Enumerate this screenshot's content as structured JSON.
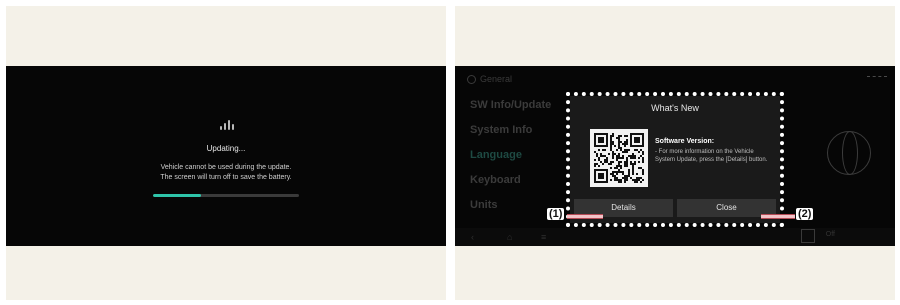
{
  "left_screen": {
    "title": "Updating...",
    "message_line1": "Vehicle cannot be used during the update.",
    "message_line2": "The screen will turn off to save the battery.",
    "progress_fraction": 0.33,
    "icons": {
      "spinner": "loading-icon"
    }
  },
  "right_screen": {
    "background": {
      "header": "General",
      "menu": [
        {
          "label": "SW Info/Update",
          "accent": false
        },
        {
          "label": "System Info",
          "accent": false
        },
        {
          "label": "Language",
          "accent": true
        },
        {
          "label": "Keyboard",
          "accent": false
        },
        {
          "label": "Units",
          "accent": false
        }
      ],
      "off_label": "Off"
    },
    "popup": {
      "title": "What's New",
      "heading": "Software Version:",
      "description": "- For more information on the Vehicle System Update, press the [Details] button.",
      "details_label": "Details",
      "close_label": "Close"
    },
    "callouts": {
      "c1": "(1)",
      "c2": "(2)"
    }
  },
  "colors": {
    "panel_bg": "#f4f1e8",
    "screen_bg": "#060606",
    "progress_fill": "#2ec4a9",
    "popup_bg": "#1a1a1a",
    "callout_line": "#f3c3c8"
  }
}
